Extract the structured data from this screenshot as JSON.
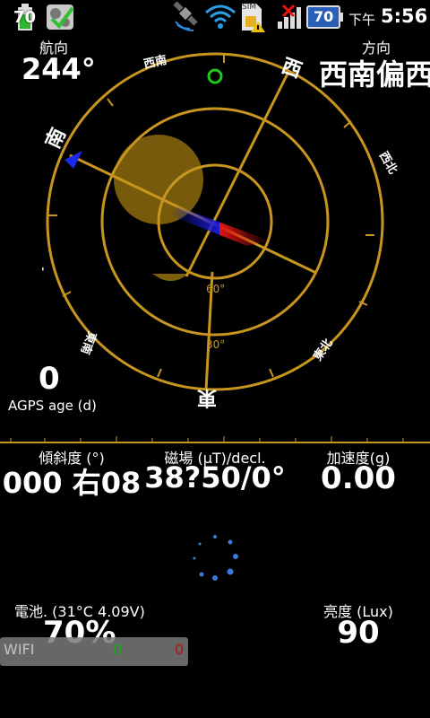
{
  "status_bar": {
    "battery_level": "70",
    "signal_badge": "70",
    "sim_label": "SIM",
    "ampm": "下午",
    "time": "5:56"
  },
  "compass": {
    "heading_label": "航向",
    "heading_value": "244°",
    "direction_label": "方向",
    "direction_value": "西南偏西",
    "cardinals": {
      "southwest": "西南",
      "west": "西",
      "northwest": "西北",
      "northeast": "東北",
      "east": "東",
      "southeast": "東南",
      "south": "南"
    },
    "elevation_labels": [
      "60°",
      "30°"
    ],
    "heading_deg": 244
  },
  "agps": {
    "value": "0",
    "label": "AGPS age (d)"
  },
  "readouts": {
    "tilt_label": "傾斜度 (°)",
    "tilt_value": "000 右08",
    "mag_label": "磁場 (µT)/decl.",
    "mag_value": "38?50/0°",
    "accel_label": "加速度(g)",
    "accel_value": "0.00",
    "battery_label": "電池. (31°C 4.09V)",
    "battery_value": "70%",
    "lux_label": "亮度 (Lux)",
    "lux_value": "90"
  },
  "wifi": {
    "label": "WIFI",
    "green_count": "0",
    "red_count": "0"
  },
  "colors": {
    "ring": "#c8961e",
    "accent_green": "#1ec81e",
    "accent_red": "#e11414",
    "needle_blue": "#1a1ad8"
  }
}
